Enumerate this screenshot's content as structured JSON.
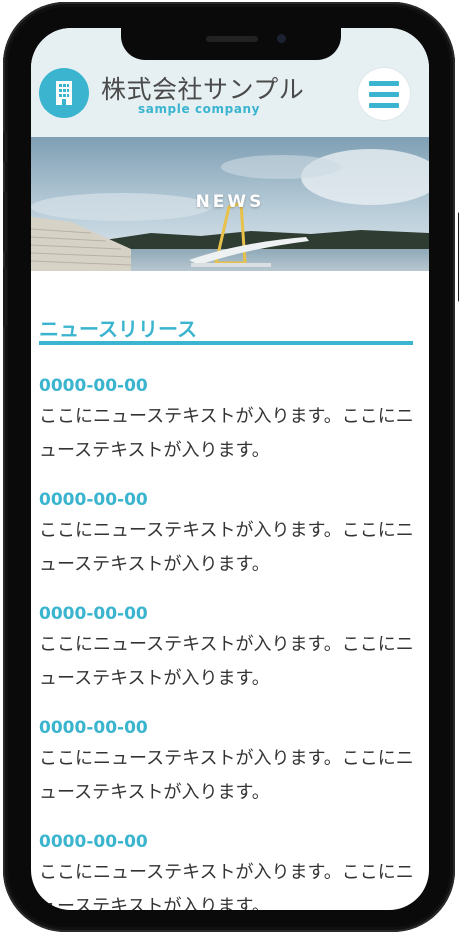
{
  "header": {
    "company_name": "株式会社サンプル",
    "company_sub": "sample company",
    "logo_icon": "building-icon",
    "menu_icon": "hamburger-icon"
  },
  "hero": {
    "title": "NEWS"
  },
  "section": {
    "title": "ニュースリリース"
  },
  "news": [
    {
      "date": "0000-00-00",
      "text": "ここにニューステキストが入ります。ここにニューステキストが入ります。"
    },
    {
      "date": "0000-00-00",
      "text": "ここにニューステキストが入ります。ここにニューステキストが入ります。"
    },
    {
      "date": "0000-00-00",
      "text": "ここにニューステキストが入ります。ここにニューステキストが入ります。"
    },
    {
      "date": "0000-00-00",
      "text": "ここにニューステキストが入ります。ここにニューステキストが入ります。"
    },
    {
      "date": "0000-00-00",
      "text": "ここにニューステキストが入ります。ここにニューステキストが入ります。"
    }
  ],
  "colors": {
    "accent": "#3ab4cf",
    "header_bg": "#e6f0f3",
    "text": "#333333"
  }
}
